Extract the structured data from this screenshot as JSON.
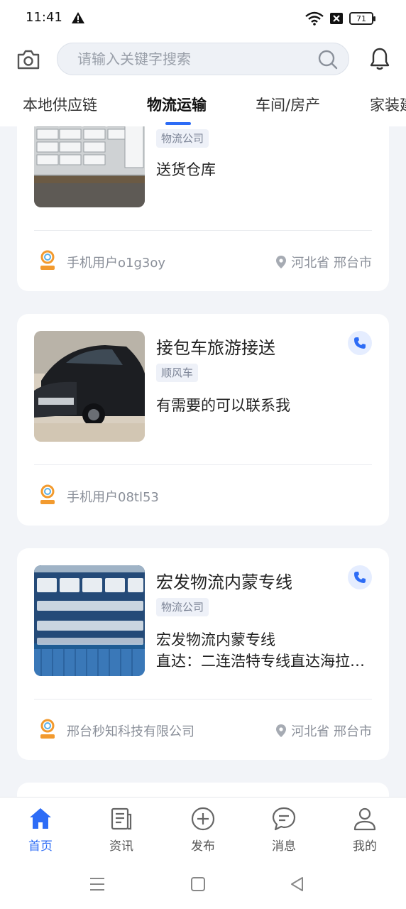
{
  "status_bar": {
    "time": "11:41",
    "battery": "71"
  },
  "search": {
    "placeholder": "请输入关键字搜索"
  },
  "tabs": [
    {
      "label": "本地供应链",
      "active": false
    },
    {
      "label": "物流运输",
      "active": true
    },
    {
      "label": "车间/房产",
      "active": false
    },
    {
      "label": "家装建",
      "active": false
    }
  ],
  "cards": [
    {
      "tag": "物流公司",
      "desc": [
        "送货仓库"
      ],
      "seller": "手机用户o1g3oy",
      "location": "河北省 邢台市"
    },
    {
      "title": "接包车旅游接送",
      "tag": "顺风车",
      "desc": [
        "有需要的可以联系我"
      ],
      "seller": "手机用户08tl53"
    },
    {
      "title": "宏发物流内蒙专线",
      "tag": "物流公司",
      "desc": [
        "宏发物流内蒙专线",
        "直达：二连浩特专线直达海拉尔…"
      ],
      "seller": "邢台秒知科技有限公司",
      "location": "河北省 邢台市"
    }
  ],
  "bottom_nav": [
    {
      "label": "首页",
      "icon": "home-icon",
      "active": true
    },
    {
      "label": "资讯",
      "icon": "news-icon",
      "active": false
    },
    {
      "label": "发布",
      "icon": "publish-plus-icon",
      "active": false
    },
    {
      "label": "消息",
      "icon": "message-icon",
      "active": false
    },
    {
      "label": "我的",
      "icon": "profile-icon",
      "active": false
    }
  ],
  "colors": {
    "accent": "#2d6cf6",
    "background": "#f2f4f8",
    "tag_bg": "#eef1f8"
  }
}
